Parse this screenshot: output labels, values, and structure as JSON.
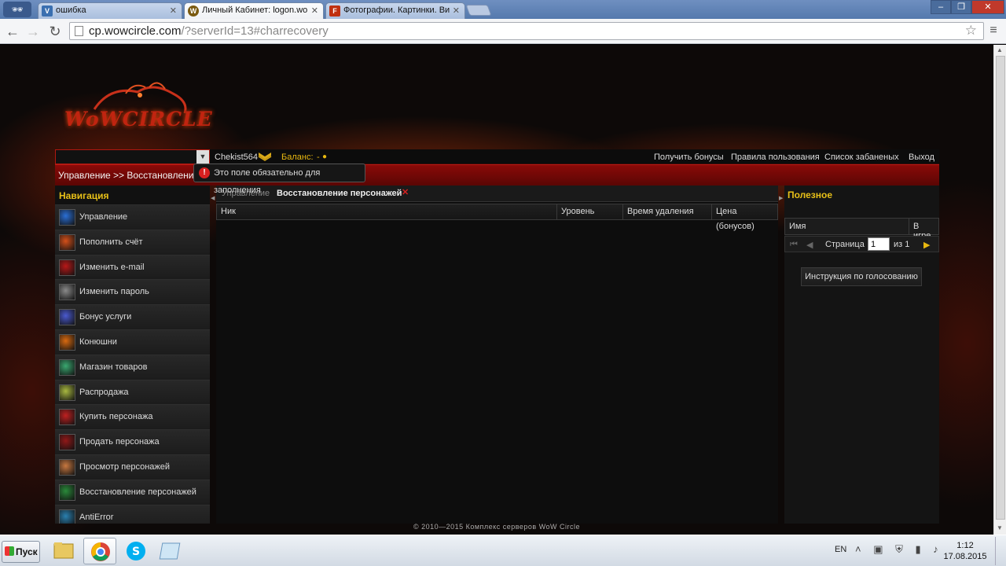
{
  "browser": {
    "tabs": [
      {
        "title": "ошибка",
        "icon": "V"
      },
      {
        "title": "Личный Кабинет: logon.wo",
        "icon": "W"
      },
      {
        "title": "Фотографии. Картинки. Ви",
        "icon": "F"
      }
    ],
    "url_host": "cp.wowcircle.com",
    "url_rest": "/?serverId=13#charrecovery",
    "window_buttons": [
      "–",
      "❐",
      "✕"
    ]
  },
  "site": {
    "logo_text": "WoWCIRCLE",
    "username": "Chekist564",
    "balance_label": "Баланс:",
    "balance_value": "-",
    "top_links": [
      "Получить бонусы",
      "Правила пользования",
      "Список забаненых",
      "Выход"
    ],
    "breadcrumb": "Управление >> Восстановление",
    "tooltip": "Это поле обязательно для заполнения"
  },
  "nav": {
    "title": "Навигация",
    "items": [
      {
        "label": "Управление",
        "color": "#2a6fd6"
      },
      {
        "label": "Пополнить счёт",
        "color": "#d4501a"
      },
      {
        "label": "Изменить e-mail",
        "color": "#b81818"
      },
      {
        "label": "Изменить пароль",
        "color": "#8a8a8a"
      },
      {
        "label": "Бонус услуги",
        "color": "#4a5ad0"
      },
      {
        "label": "Конюшни",
        "color": "#d86a10"
      },
      {
        "label": "Магазин товаров",
        "color": "#3aa870"
      },
      {
        "label": "Распродажа",
        "color": "#a8b840"
      },
      {
        "label": "Купить персонажа",
        "color": "#c02020"
      },
      {
        "label": "Продать персонажа",
        "color": "#901818"
      },
      {
        "label": "Просмотр персонажей",
        "color": "#c87840"
      },
      {
        "label": "Восстановление персонажей",
        "color": "#2a8a3a"
      },
      {
        "label": "AntiError",
        "color": "#2a80b0"
      }
    ]
  },
  "main": {
    "tabs": [
      "Управление",
      "Восстановление персонажей"
    ],
    "tab_close": "✕",
    "columns": [
      "Ник",
      "Уровень",
      "Время удаления",
      "Цена (бонусов)"
    ]
  },
  "useful": {
    "title": "Полезное",
    "columns": [
      "Имя",
      "В игре"
    ],
    "page_label": "Страница",
    "page_value": "1",
    "page_total": "из 1",
    "vote_button": "Инструкция по голосованию"
  },
  "footer": "© 2010—2015 Комплекс серверов WoW Circle",
  "taskbar": {
    "start": "Пуск",
    "lang": "EN",
    "time": "1:12",
    "date": "17.08.2015"
  }
}
